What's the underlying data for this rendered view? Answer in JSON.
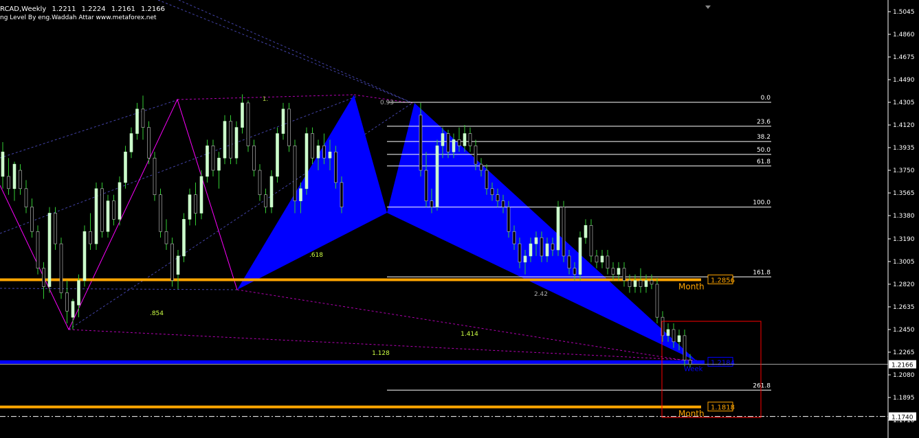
{
  "header": {
    "symbol": "RCAD,Weekly",
    "ohlc": [
      "1.2211",
      "1.2224",
      "1.2161",
      "1.2166"
    ],
    "indicator": "ng Level By eng.Waddah Attar www.metaforex.net"
  },
  "colors": {
    "background": "#000000",
    "bull_candle": "#ccffcc",
    "bear_candle": "#000000",
    "candle_wick": "#33cc33",
    "pattern_fill": "#0000ff",
    "pattern_line": "#ff00ff",
    "month_level": "#ffa500",
    "week_level": "#0000ff",
    "fib_line": "#ffffff",
    "zone_box": "#ff0000"
  },
  "chart_data": {
    "type": "candlestick",
    "timeframe": "Weekly",
    "ylim": [
      1.1645,
      1.5075
    ],
    "y_ticks": [
      "1.5045",
      "1.4860",
      "1.4675",
      "1.4490",
      "1.4305",
      "1.4120",
      "1.3935",
      "1.3750",
      "1.3565",
      "1.3380",
      "1.3190",
      "1.3005",
      "1.2820",
      "1.2635",
      "1.2450",
      "1.2265",
      "1.2080",
      "1.1895",
      "1.1710"
    ],
    "current_price": "1.2166",
    "marker_price": "1.1740",
    "x_count": 122,
    "candles": [
      {
        "i": 0,
        "o": 1.37,
        "h": 1.398,
        "l": 1.36,
        "c": 1.39
      },
      {
        "i": 2,
        "o": 1.37,
        "h": 1.385,
        "l": 1.355,
        "c": 1.36
      },
      {
        "i": 4,
        "o": 1.36,
        "h": 1.382,
        "l": 1.35,
        "c": 1.38
      },
      {
        "i": 6,
        "o": 1.375,
        "h": 1.38,
        "l": 1.355,
        "c": 1.36
      },
      {
        "i": 8,
        "o": 1.36,
        "h": 1.367,
        "l": 1.34,
        "c": 1.345
      },
      {
        "i": 10,
        "o": 1.345,
        "h": 1.352,
        "l": 1.32,
        "c": 1.325
      },
      {
        "i": 12,
        "o": 1.325,
        "h": 1.33,
        "l": 1.29,
        "c": 1.295
      },
      {
        "i": 14,
        "o": 1.295,
        "h": 1.3,
        "l": 1.27,
        "c": 1.28
      },
      {
        "i": 16,
        "o": 1.28,
        "h": 1.345,
        "l": 1.275,
        "c": 1.34
      },
      {
        "i": 18,
        "o": 1.34,
        "h": 1.345,
        "l": 1.31,
        "c": 1.315
      },
      {
        "i": 20,
        "o": 1.315,
        "h": 1.32,
        "l": 1.27,
        "c": 1.275
      },
      {
        "i": 22,
        "o": 1.275,
        "h": 1.285,
        "l": 1.25,
        "c": 1.26
      },
      {
        "i": 24,
        "o": 1.255,
        "h": 1.27,
        "l": 1.245,
        "c": 1.268
      },
      {
        "i": 26,
        "o": 1.265,
        "h": 1.29,
        "l": 1.255,
        "c": 1.285
      },
      {
        "i": 28,
        "o": 1.285,
        "h": 1.33,
        "l": 1.28,
        "c": 1.325
      },
      {
        "i": 30,
        "o": 1.325,
        "h": 1.34,
        "l": 1.31,
        "c": 1.315
      },
      {
        "i": 32,
        "o": 1.315,
        "h": 1.365,
        "l": 1.31,
        "c": 1.36
      },
      {
        "i": 34,
        "o": 1.36,
        "h": 1.365,
        "l": 1.32,
        "c": 1.325
      },
      {
        "i": 36,
        "o": 1.325,
        "h": 1.355,
        "l": 1.32,
        "c": 1.35
      },
      {
        "i": 38,
        "o": 1.35,
        "h": 1.355,
        "l": 1.33,
        "c": 1.335
      },
      {
        "i": 40,
        "o": 1.335,
        "h": 1.37,
        "l": 1.33,
        "c": 1.365
      },
      {
        "i": 42,
        "o": 1.365,
        "h": 1.395,
        "l": 1.36,
        "c": 1.39
      },
      {
        "i": 44,
        "o": 1.39,
        "h": 1.41,
        "l": 1.385,
        "c": 1.405
      },
      {
        "i": 46,
        "o": 1.405,
        "h": 1.43,
        "l": 1.4,
        "c": 1.425
      },
      {
        "i": 48,
        "o": 1.425,
        "h": 1.436,
        "l": 1.4,
        "c": 1.41
      },
      {
        "i": 50,
        "o": 1.41,
        "h": 1.415,
        "l": 1.38,
        "c": 1.385
      },
      {
        "i": 52,
        "o": 1.385,
        "h": 1.39,
        "l": 1.35,
        "c": 1.355
      },
      {
        "i": 54,
        "o": 1.355,
        "h": 1.36,
        "l": 1.32,
        "c": 1.325
      },
      {
        "i": 56,
        "o": 1.325,
        "h": 1.335,
        "l": 1.31,
        "c": 1.315
      },
      {
        "i": 58,
        "o": 1.315,
        "h": 1.32,
        "l": 1.28,
        "c": 1.285
      },
      {
        "i": 60,
        "o": 1.29,
        "h": 1.31,
        "l": 1.278,
        "c": 1.305
      },
      {
        "i": 62,
        "o": 1.305,
        "h": 1.34,
        "l": 1.3,
        "c": 1.335
      },
      {
        "i": 64,
        "o": 1.335,
        "h": 1.36,
        "l": 1.33,
        "c": 1.355
      },
      {
        "i": 66,
        "o": 1.355,
        "h": 1.365,
        "l": 1.33,
        "c": 1.34
      },
      {
        "i": 68,
        "o": 1.34,
        "h": 1.375,
        "l": 1.335,
        "c": 1.37
      },
      {
        "i": 70,
        "o": 1.37,
        "h": 1.4,
        "l": 1.365,
        "c": 1.395
      },
      {
        "i": 72,
        "o": 1.395,
        "h": 1.4,
        "l": 1.37,
        "c": 1.375
      },
      {
        "i": 74,
        "o": 1.375,
        "h": 1.39,
        "l": 1.36,
        "c": 1.385
      },
      {
        "i": 76,
        "o": 1.385,
        "h": 1.42,
        "l": 1.38,
        "c": 1.415
      },
      {
        "i": 78,
        "o": 1.415,
        "h": 1.42,
        "l": 1.38,
        "c": 1.385
      },
      {
        "i": 80,
        "o": 1.385,
        "h": 1.415,
        "l": 1.38,
        "c": 1.41
      },
      {
        "i": 82,
        "o": 1.41,
        "h": 1.437,
        "l": 1.405,
        "c": 1.43
      },
      {
        "i": 84,
        "o": 1.43,
        "h": 1.432,
        "l": 1.39,
        "c": 1.395
      },
      {
        "i": 86,
        "o": 1.395,
        "h": 1.4,
        "l": 1.37,
        "c": 1.375
      },
      {
        "i": 88,
        "o": 1.375,
        "h": 1.38,
        "l": 1.35,
        "c": 1.355
      },
      {
        "i": 90,
        "o": 1.355,
        "h": 1.36,
        "l": 1.34,
        "c": 1.345
      },
      {
        "i": 92,
        "o": 1.345,
        "h": 1.375,
        "l": 1.34,
        "c": 1.37
      },
      {
        "i": 94,
        "o": 1.37,
        "h": 1.41,
        "l": 1.365,
        "c": 1.405
      },
      {
        "i": 96,
        "o": 1.405,
        "h": 1.43,
        "l": 1.4,
        "c": 1.425
      },
      {
        "i": 98,
        "o": 1.425,
        "h": 1.43,
        "l": 1.39,
        "c": 1.395
      },
      {
        "i": 100,
        "o": 1.395,
        "h": 1.4,
        "l": 1.34,
        "c": 1.35
      },
      {
        "i": 102,
        "o": 1.35,
        "h": 1.365,
        "l": 1.34,
        "c": 1.36
      },
      {
        "i": 104,
        "o": 1.36,
        "h": 1.41,
        "l": 1.355,
        "c": 1.405
      },
      {
        "i": 106,
        "o": 1.405,
        "h": 1.41,
        "l": 1.38,
        "c": 1.385
      },
      {
        "i": 108,
        "o": 1.385,
        "h": 1.4,
        "l": 1.375,
        "c": 1.395
      },
      {
        "i": 110,
        "o": 1.395,
        "h": 1.405,
        "l": 1.38,
        "c": 1.385
      },
      {
        "i": 112,
        "o": 1.385,
        "h": 1.4,
        "l": 1.375,
        "c": 1.39
      },
      {
        "i": 114,
        "o": 1.39,
        "h": 1.395,
        "l": 1.36,
        "c": 1.365
      },
      {
        "i": 116,
        "o": 1.365,
        "h": 1.37,
        "l": 1.34,
        "c": 1.345
      }
    ],
    "candles_right": [
      {
        "x": 612,
        "o": 1.42,
        "h": 1.43,
        "l": 1.37,
        "c": 1.375
      },
      {
        "x": 620,
        "o": 1.375,
        "h": 1.39,
        "l": 1.345,
        "c": 1.35
      },
      {
        "x": 628,
        "o": 1.35,
        "h": 1.36,
        "l": 1.34,
        "c": 1.345
      },
      {
        "x": 636,
        "o": 1.345,
        "h": 1.4,
        "l": 1.342,
        "c": 1.395
      },
      {
        "x": 644,
        "o": 1.395,
        "h": 1.41,
        "l": 1.385,
        "c": 1.405
      },
      {
        "x": 652,
        "o": 1.405,
        "h": 1.408,
        "l": 1.385,
        "c": 1.39
      },
      {
        "x": 660,
        "o": 1.39,
        "h": 1.405,
        "l": 1.385,
        "c": 1.4
      },
      {
        "x": 668,
        "o": 1.4,
        "h": 1.41,
        "l": 1.39,
        "c": 1.395
      },
      {
        "x": 676,
        "o": 1.395,
        "h": 1.412,
        "l": 1.39,
        "c": 1.405
      },
      {
        "x": 684,
        "o": 1.405,
        "h": 1.41,
        "l": 1.39,
        "c": 1.395
      },
      {
        "x": 692,
        "o": 1.395,
        "h": 1.4,
        "l": 1.375,
        "c": 1.38
      },
      {
        "x": 700,
        "o": 1.38,
        "h": 1.385,
        "l": 1.37,
        "c": 1.375
      },
      {
        "x": 708,
        "o": 1.375,
        "h": 1.38,
        "l": 1.355,
        "c": 1.36
      },
      {
        "x": 716,
        "o": 1.36,
        "h": 1.365,
        "l": 1.35,
        "c": 1.355
      },
      {
        "x": 724,
        "o": 1.355,
        "h": 1.36,
        "l": 1.345,
        "c": 1.35
      },
      {
        "x": 732,
        "o": 1.35,
        "h": 1.355,
        "l": 1.34,
        "c": 1.345
      },
      {
        "x": 740,
        "o": 1.345,
        "h": 1.35,
        "l": 1.32,
        "c": 1.325
      },
      {
        "x": 748,
        "o": 1.325,
        "h": 1.33,
        "l": 1.31,
        "c": 1.315
      },
      {
        "x": 756,
        "o": 1.315,
        "h": 1.32,
        "l": 1.295,
        "c": 1.3
      },
      {
        "x": 764,
        "o": 1.3,
        "h": 1.31,
        "l": 1.29,
        "c": 1.305
      },
      {
        "x": 772,
        "o": 1.305,
        "h": 1.32,
        "l": 1.3,
        "c": 1.315
      },
      {
        "x": 780,
        "o": 1.315,
        "h": 1.325,
        "l": 1.305,
        "c": 1.32
      },
      {
        "x": 788,
        "o": 1.32,
        "h": 1.325,
        "l": 1.3,
        "c": 1.305
      },
      {
        "x": 796,
        "o": 1.305,
        "h": 1.32,
        "l": 1.3,
        "c": 1.315
      },
      {
        "x": 804,
        "o": 1.315,
        "h": 1.32,
        "l": 1.305,
        "c": 1.31
      },
      {
        "x": 812,
        "o": 1.31,
        "h": 1.35,
        "l": 1.305,
        "c": 1.345
      },
      {
        "x": 820,
        "o": 1.345,
        "h": 1.35,
        "l": 1.3,
        "c": 1.305
      },
      {
        "x": 828,
        "o": 1.305,
        "h": 1.31,
        "l": 1.29,
        "c": 1.295
      },
      {
        "x": 836,
        "o": 1.295,
        "h": 1.3,
        "l": 1.285,
        "c": 1.29
      },
      {
        "x": 844,
        "o": 1.29,
        "h": 1.325,
        "l": 1.285,
        "c": 1.32
      },
      {
        "x": 852,
        "o": 1.32,
        "h": 1.335,
        "l": 1.315,
        "c": 1.33
      },
      {
        "x": 860,
        "o": 1.33,
        "h": 1.335,
        "l": 1.3,
        "c": 1.305
      },
      {
        "x": 868,
        "o": 1.305,
        "h": 1.31,
        "l": 1.295,
        "c": 1.3
      },
      {
        "x": 876,
        "o": 1.3,
        "h": 1.31,
        "l": 1.295,
        "c": 1.305
      },
      {
        "x": 884,
        "o": 1.305,
        "h": 1.31,
        "l": 1.29,
        "c": 1.295
      },
      {
        "x": 892,
        "o": 1.295,
        "h": 1.3,
        "l": 1.285,
        "c": 1.29
      },
      {
        "x": 900,
        "o": 1.29,
        "h": 1.3,
        "l": 1.285,
        "c": 1.295
      },
      {
        "x": 908,
        "o": 1.295,
        "h": 1.3,
        "l": 1.28,
        "c": 1.285
      },
      {
        "x": 916,
        "o": 1.285,
        "h": 1.29,
        "l": 1.275,
        "c": 1.28
      },
      {
        "x": 924,
        "o": 1.28,
        "h": 1.29,
        "l": 1.275,
        "c": 1.285
      },
      {
        "x": 932,
        "o": 1.285,
        "h": 1.295,
        "l": 1.275,
        "c": 1.28
      },
      {
        "x": 940,
        "o": 1.28,
        "h": 1.29,
        "l": 1.275,
        "c": 1.285
      },
      {
        "x": 948,
        "o": 1.285,
        "h": 1.29,
        "l": 1.278,
        "c": 1.282
      },
      {
        "x": 956,
        "o": 1.282,
        "h": 1.287,
        "l": 1.25,
        "c": 1.255
      },
      {
        "x": 964,
        "o": 1.255,
        "h": 1.26,
        "l": 1.235,
        "c": 1.24
      },
      {
        "x": 972,
        "o": 1.24,
        "h": 1.25,
        "l": 1.235,
        "c": 1.245
      },
      {
        "x": 980,
        "o": 1.245,
        "h": 1.25,
        "l": 1.23,
        "c": 1.235
      },
      {
        "x": 988,
        "o": 1.235,
        "h": 1.245,
        "l": 1.228,
        "c": 1.24
      },
      {
        "x": 996,
        "o": 1.24,
        "h": 1.245,
        "l": 1.215,
        "c": 1.22
      },
      {
        "x": 1004,
        "o": 1.22,
        "h": 1.225,
        "l": 1.214,
        "c": 1.2166
      }
    ],
    "fib_levels": [
      {
        "label": "0.0",
        "price": 1.4305
      },
      {
        "label": "23.6",
        "price": 1.411
      },
      {
        "label": "38.2",
        "price": 1.3985
      },
      {
        "label": "50.0",
        "price": 1.388
      },
      {
        "label": "61.8",
        "price": 1.3785
      },
      {
        "label": "100.0",
        "price": 1.345
      },
      {
        "label": "161.8",
        "price": 1.288
      },
      {
        "label": "261.8",
        "price": 1.1955
      }
    ],
    "month_levels": [
      {
        "label": "Month",
        "value": "1.2856",
        "price": 1.2856
      },
      {
        "label": "Month",
        "value": "1.1818",
        "price": 1.1818
      }
    ],
    "week_level": {
      "label": "Week",
      "value": "1.2184",
      "price": 1.2184
    },
    "pattern_labels": [
      "1.",
      "0.93",
      ".618",
      ".854",
      "2.42",
      "1.414",
      "1.128"
    ]
  }
}
